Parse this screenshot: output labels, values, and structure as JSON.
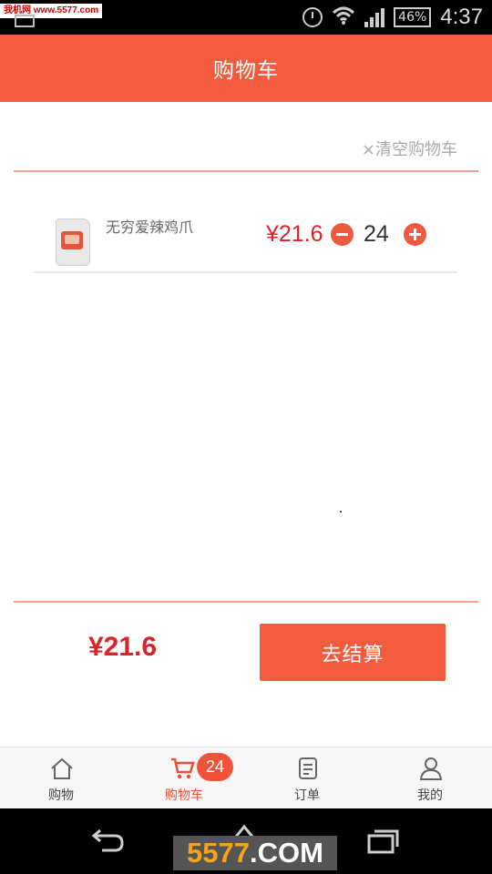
{
  "status_bar": {
    "watermark": "我机网 www.5577.com",
    "battery": "46%",
    "time": "4:37"
  },
  "header": {
    "title": "购物车"
  },
  "cart": {
    "clear_label": "×清空购物车",
    "items": [
      {
        "name": "无穷爱辣鸡爪",
        "price": "¥21.6",
        "quantity": "24"
      }
    ]
  },
  "footer": {
    "total": "¥21.6",
    "checkout_label": "去结算"
  },
  "tabbar": {
    "tabs": [
      {
        "label": "购物",
        "icon": "home-icon"
      },
      {
        "label": "购物车",
        "icon": "cart-icon",
        "badge": "24",
        "active": true
      },
      {
        "label": "订单",
        "icon": "orders-icon"
      },
      {
        "label": "我的",
        "icon": "user-icon"
      }
    ],
    "active_color": "#e75235"
  },
  "watermark": {
    "prefix": "5577",
    "suffix": ".COM"
  },
  "colors": {
    "accent": "#f35b3f",
    "price": "#d8252b"
  }
}
